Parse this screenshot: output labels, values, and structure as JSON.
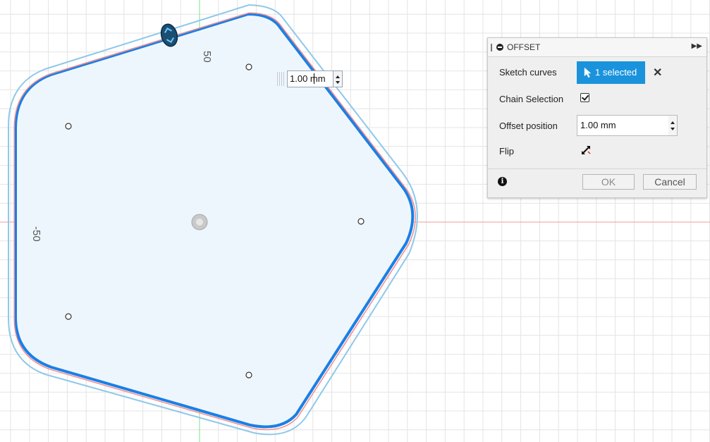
{
  "canvas": {
    "axis_labels": {
      "y_positive": "50",
      "x_negative": "-50"
    },
    "colors": {
      "grid": "#e4e4e4",
      "x_axis": "#f29b9b",
      "y_axis": "#7fe08a",
      "profile_fill": "#eef6fd",
      "profile_stroke": "#1a7fe6",
      "offset_outer": "#8fc8ea",
      "offset_inner": "#f08e8e"
    },
    "dimension_input": {
      "value": "1.00 mm"
    }
  },
  "panel": {
    "title": "OFFSET",
    "rows": {
      "sketch_curves_label": "Sketch curves",
      "selected_text": "1 selected",
      "chain_selection_label": "Chain Selection",
      "chain_selection_checked": true,
      "offset_position_label": "Offset position",
      "offset_position_value": "1.00 mm",
      "flip_label": "Flip"
    },
    "buttons": {
      "ok": "OK",
      "cancel": "Cancel"
    },
    "colors": {
      "selected_button": "#1a93dc"
    }
  }
}
